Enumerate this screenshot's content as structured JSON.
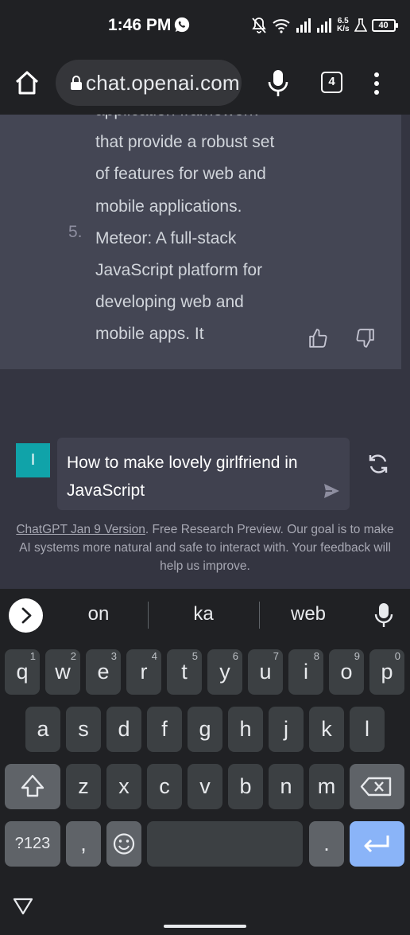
{
  "status_bar": {
    "time": "1:46 PM",
    "net_speed_value": "6.5",
    "net_speed_unit": "K/s",
    "battery": "40",
    "icons": [
      "whatsapp-icon",
      "mute-icon",
      "wifi-icon",
      "signal-icon",
      "signal-icon",
      "flask-icon",
      "battery-icon"
    ]
  },
  "browser": {
    "url": "chat.openai.com",
    "tab_count": "4",
    "icons": [
      "home-icon",
      "lock-icon",
      "mic-icon",
      "tab-switcher-icon",
      "more-vert-icon"
    ]
  },
  "response": {
    "lines": [
      "application framework",
      "that provide a robust set",
      "of features for web and",
      "mobile applications.",
      "Meteor: A full-stack",
      "JavaScript platform for",
      "developing web and",
      "mobile apps. It"
    ],
    "list_number": "5."
  },
  "prompt": {
    "avatar_letter": "I",
    "text": "How to make lovely girlfriend in JavaScript"
  },
  "footer": {
    "link_text": "ChatGPT Jan 9 Version",
    "rest_text": ". Free Research Preview. Our goal is to make AI systems more natural and safe to interact with. Your feedback will help us improve."
  },
  "keyboard": {
    "suggestions": [
      "on",
      "ka",
      "web"
    ],
    "row1": [
      {
        "key": "q",
        "hint": "1"
      },
      {
        "key": "w",
        "hint": "2"
      },
      {
        "key": "e",
        "hint": "3"
      },
      {
        "key": "r",
        "hint": "4"
      },
      {
        "key": "t",
        "hint": "5"
      },
      {
        "key": "y",
        "hint": "6"
      },
      {
        "key": "u",
        "hint": "7"
      },
      {
        "key": "i",
        "hint": "8"
      },
      {
        "key": "o",
        "hint": "9"
      },
      {
        "key": "p",
        "hint": "0"
      }
    ],
    "row2": [
      "a",
      "s",
      "d",
      "f",
      "g",
      "h",
      "j",
      "k",
      "l"
    ],
    "row3": [
      "z",
      "x",
      "c",
      "v",
      "b",
      "n",
      "m"
    ],
    "symbols_label": "?123",
    "comma": ",",
    "period": "."
  },
  "colors": {
    "page_bg": "#343541",
    "response_bg": "#444654",
    "avatar_bg": "#10a3a9",
    "enter_key": "#8ab4f8"
  }
}
